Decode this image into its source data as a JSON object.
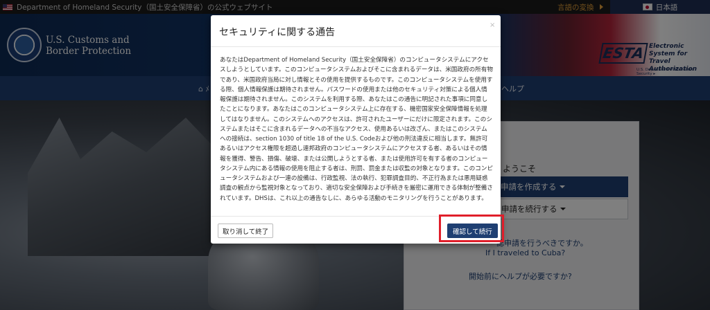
{
  "topbar": {
    "official_site": "Department of Homeland Security（国土安全保障省）の公式ウェブサイト",
    "change_language": "言語の変換",
    "current_language": "日本語"
  },
  "header": {
    "agency_line1": "U.S. Customs and",
    "agency_line2": "Border Protection",
    "esta_logo": "ESTA",
    "esta_line1": "Electronic System for",
    "esta_line2": "Travel Authorization",
    "esta_dept": "U.S. Department of Homeland Security ▸"
  },
  "nav": {
    "home_fragment": "⌂ ﾒ",
    "help_fragment": "ヘルプ"
  },
  "panel": {
    "welcome": "ようこそ",
    "create_button": "申請を作成する",
    "continue_button": "申請を続行する",
    "link_should_apply": "認申請を行うべきですか。",
    "link_cuba": "If I traveled to Cuba?",
    "link_help": "開始前にヘルプが必要ですか?"
  },
  "modal": {
    "title": "セキュリティに関する通告",
    "close": "×",
    "body": "あなたはDepartment of Homeland Security（国土安全保障省）のコンピュータシステムにアクセスしようとしています。このコンピュータシステムおよびそこに含まれるデータは、米国政府の所有物であり、米国政府当局に対し情報とその使用を提供するものです。このコンピュータシステムを使用する際、個人情報保護は期待されません。パスワードの使用または他のセキュリティ対策による個人情報保護は期待されません。このシステムを利用する際、あなたはこの通告に明記された事項に同意したことになります。あなたはこのコンピュータシステム上に存在する、機密国家安全保障情報を処理してはなりません。このシステムへのアクセスは、許可されたユーザーにだけに限定されます。このシステムまたはそこに含まれるデータへの不当なアクセス、使用あるいは改ざん、またはこのシステムへの接続は、section 1030 of title 18 of the U.S. Codeおよび他の刑法違反に相当します。無許可あるいはアクセス権限を超過し連邦政府のコンピュータシステムにアクセスする者、あるいはその情報を獲得、警告、損傷、破壊、または公開しようとする者、または使用許可を有する者のコンピュータシステム内にある情報の使用を阻止する者は、刑罰、罰金または収監の対象となります。このコンピュータシステムおよび一連の設備は、行政監視、法の執行、犯罪調査目的、不正行為または悪用疑惑調査の観点から監視対象となっており、適切な安全保障および手続きを厳密に運用できる体制が整備されています。DHSは、これ以上の通告なしに、あらゆる活動のモニタリングを行うことがあります。",
    "cancel_button": "取り消して終了",
    "confirm_button": "確認して続行"
  },
  "colors": {
    "navy": "#1e3f72",
    "highlight_red": "#e01e2a",
    "language_orange": "#e8a33a"
  }
}
